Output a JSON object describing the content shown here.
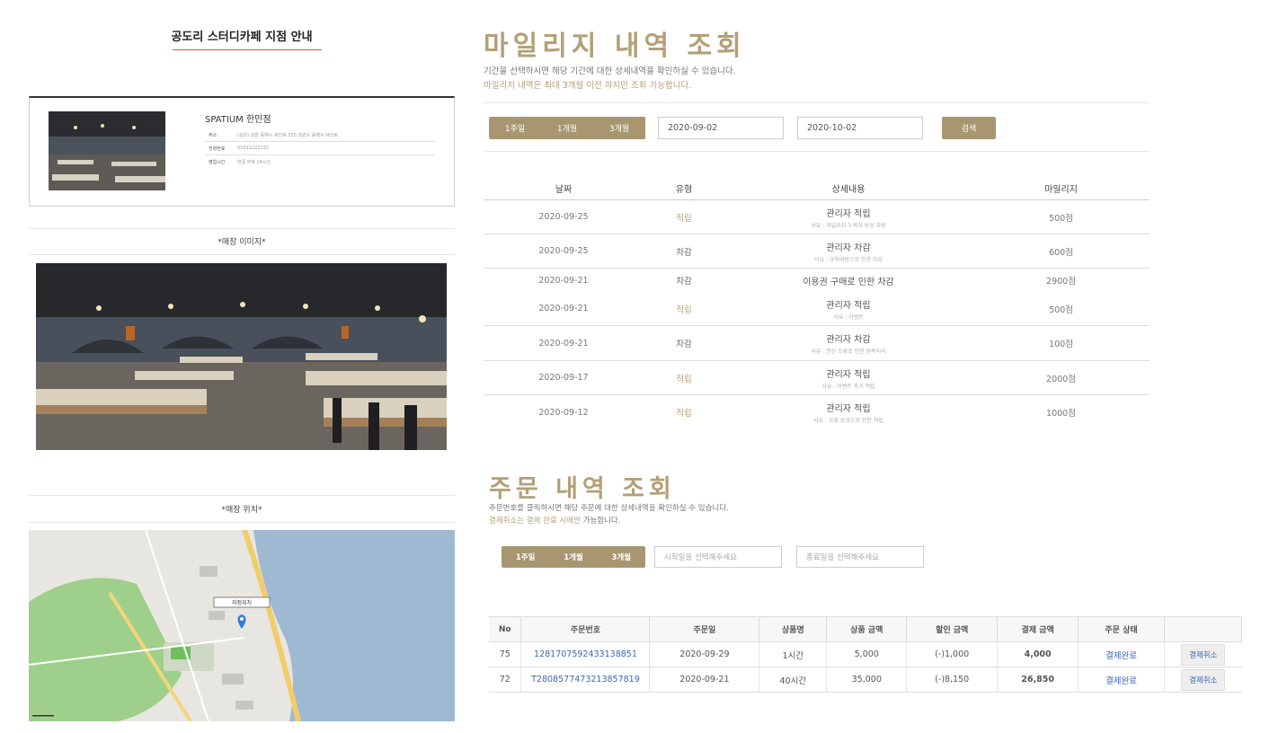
{
  "store": {
    "heading": "공도리 스터디카페 지점 안내",
    "name": "SPATIUM 한민점",
    "info": [
      {
        "label": "주소",
        "value": "(강원) 강원 동해시 새안로 350 강원도 동해시 새안로"
      },
      {
        "label": "전화번호",
        "value": "01011222222"
      },
      {
        "label": "영업시간",
        "value": "연중 무휴 24시간"
      }
    ],
    "image_label": "*매장 이미지*",
    "location_label": "*매장 위치*",
    "map_marker_label": "지점위치"
  },
  "mileage": {
    "title": "마일리지 내역 조회",
    "desc1": "기간을 선택하시면 해당 기간에 대한 상세내역을 확인하실 수 있습니다.",
    "desc2": "마일리지 내역은 최대 3개월 이전 까지만 조회 가능합니다.",
    "periods": [
      "1주일",
      "1개월",
      "3개월"
    ],
    "start_date": "2020-09-02",
    "end_date": "2020-10-02",
    "search_label": "검색",
    "columns": [
      "날짜",
      "유형",
      "상세내용",
      "마일리지"
    ],
    "rows": [
      {
        "date": "2020-09-25",
        "type": "적립",
        "kind": "earn",
        "detail": "관리자 적립",
        "note": "사유 : 마일리지 누락자 보상 차원",
        "amount": "500점"
      },
      {
        "date": "2020-09-25",
        "type": "차감",
        "kind": "use",
        "detail": "관리자 차감",
        "note": "사유 : 규칙위반으로 인한 차감",
        "amount": "600점"
      },
      {
        "date": "2020-09-21",
        "type": "차감",
        "kind": "use",
        "detail": "이용권 구매로 인한 차감",
        "note": "",
        "amount": "2900점"
      },
      {
        "date": "2020-09-21",
        "type": "적립",
        "kind": "earn",
        "detail": "관리자 적립",
        "note": "사유 : 이벤트",
        "amount": "500점"
      },
      {
        "date": "2020-09-21",
        "type": "차감",
        "kind": "use",
        "detail": "관리자 차감",
        "note": "사유 : 전산 오류로 인한 원복처리",
        "amount": "100점"
      },
      {
        "date": "2020-09-17",
        "type": "적립",
        "kind": "earn",
        "detail": "관리자 적립",
        "note": "사유 : 이벤트 추가 적립",
        "amount": "2000점"
      },
      {
        "date": "2020-09-12",
        "type": "적립",
        "kind": "earn",
        "detail": "관리자 적립",
        "note": "사유 : 오류 보상으로 인한 적립",
        "amount": "1000점"
      }
    ]
  },
  "orders": {
    "title": "주문 내역 조회",
    "desc1": "주문번호를 클릭하시면 해당 주문에 대한 상세내역을 확인하실 수 있습니다.",
    "desc2_highlight": "결제취소는 결제 완료 시에만",
    "desc2_rest": " 가능합니다.",
    "periods": [
      "1주일",
      "1개월",
      "3개월"
    ],
    "start_placeholder": "시작일을 선택해주세요",
    "end_placeholder": "종료일을 선택해주세요",
    "columns": [
      "No",
      "주문번호",
      "주문일",
      "상품명",
      "상품 금액",
      "할인 금액",
      "결제 금액",
      "주문 상태",
      ""
    ],
    "rows": [
      {
        "no": "75",
        "order_no": "1281707592433138851",
        "date": "2020-09-29",
        "product": "1시간",
        "price": "5,000",
        "discount": "(-)1,000",
        "paid": "4,000",
        "status": "결제완료",
        "action": "결제취소"
      },
      {
        "no": "72",
        "order_no": "T2808577473213857819",
        "date": "2020-09-21",
        "product": "40시간",
        "price": "35,000",
        "discount": "(-)8,150",
        "paid": "26,850",
        "status": "결제완료",
        "action": "결제취소"
      }
    ]
  }
}
